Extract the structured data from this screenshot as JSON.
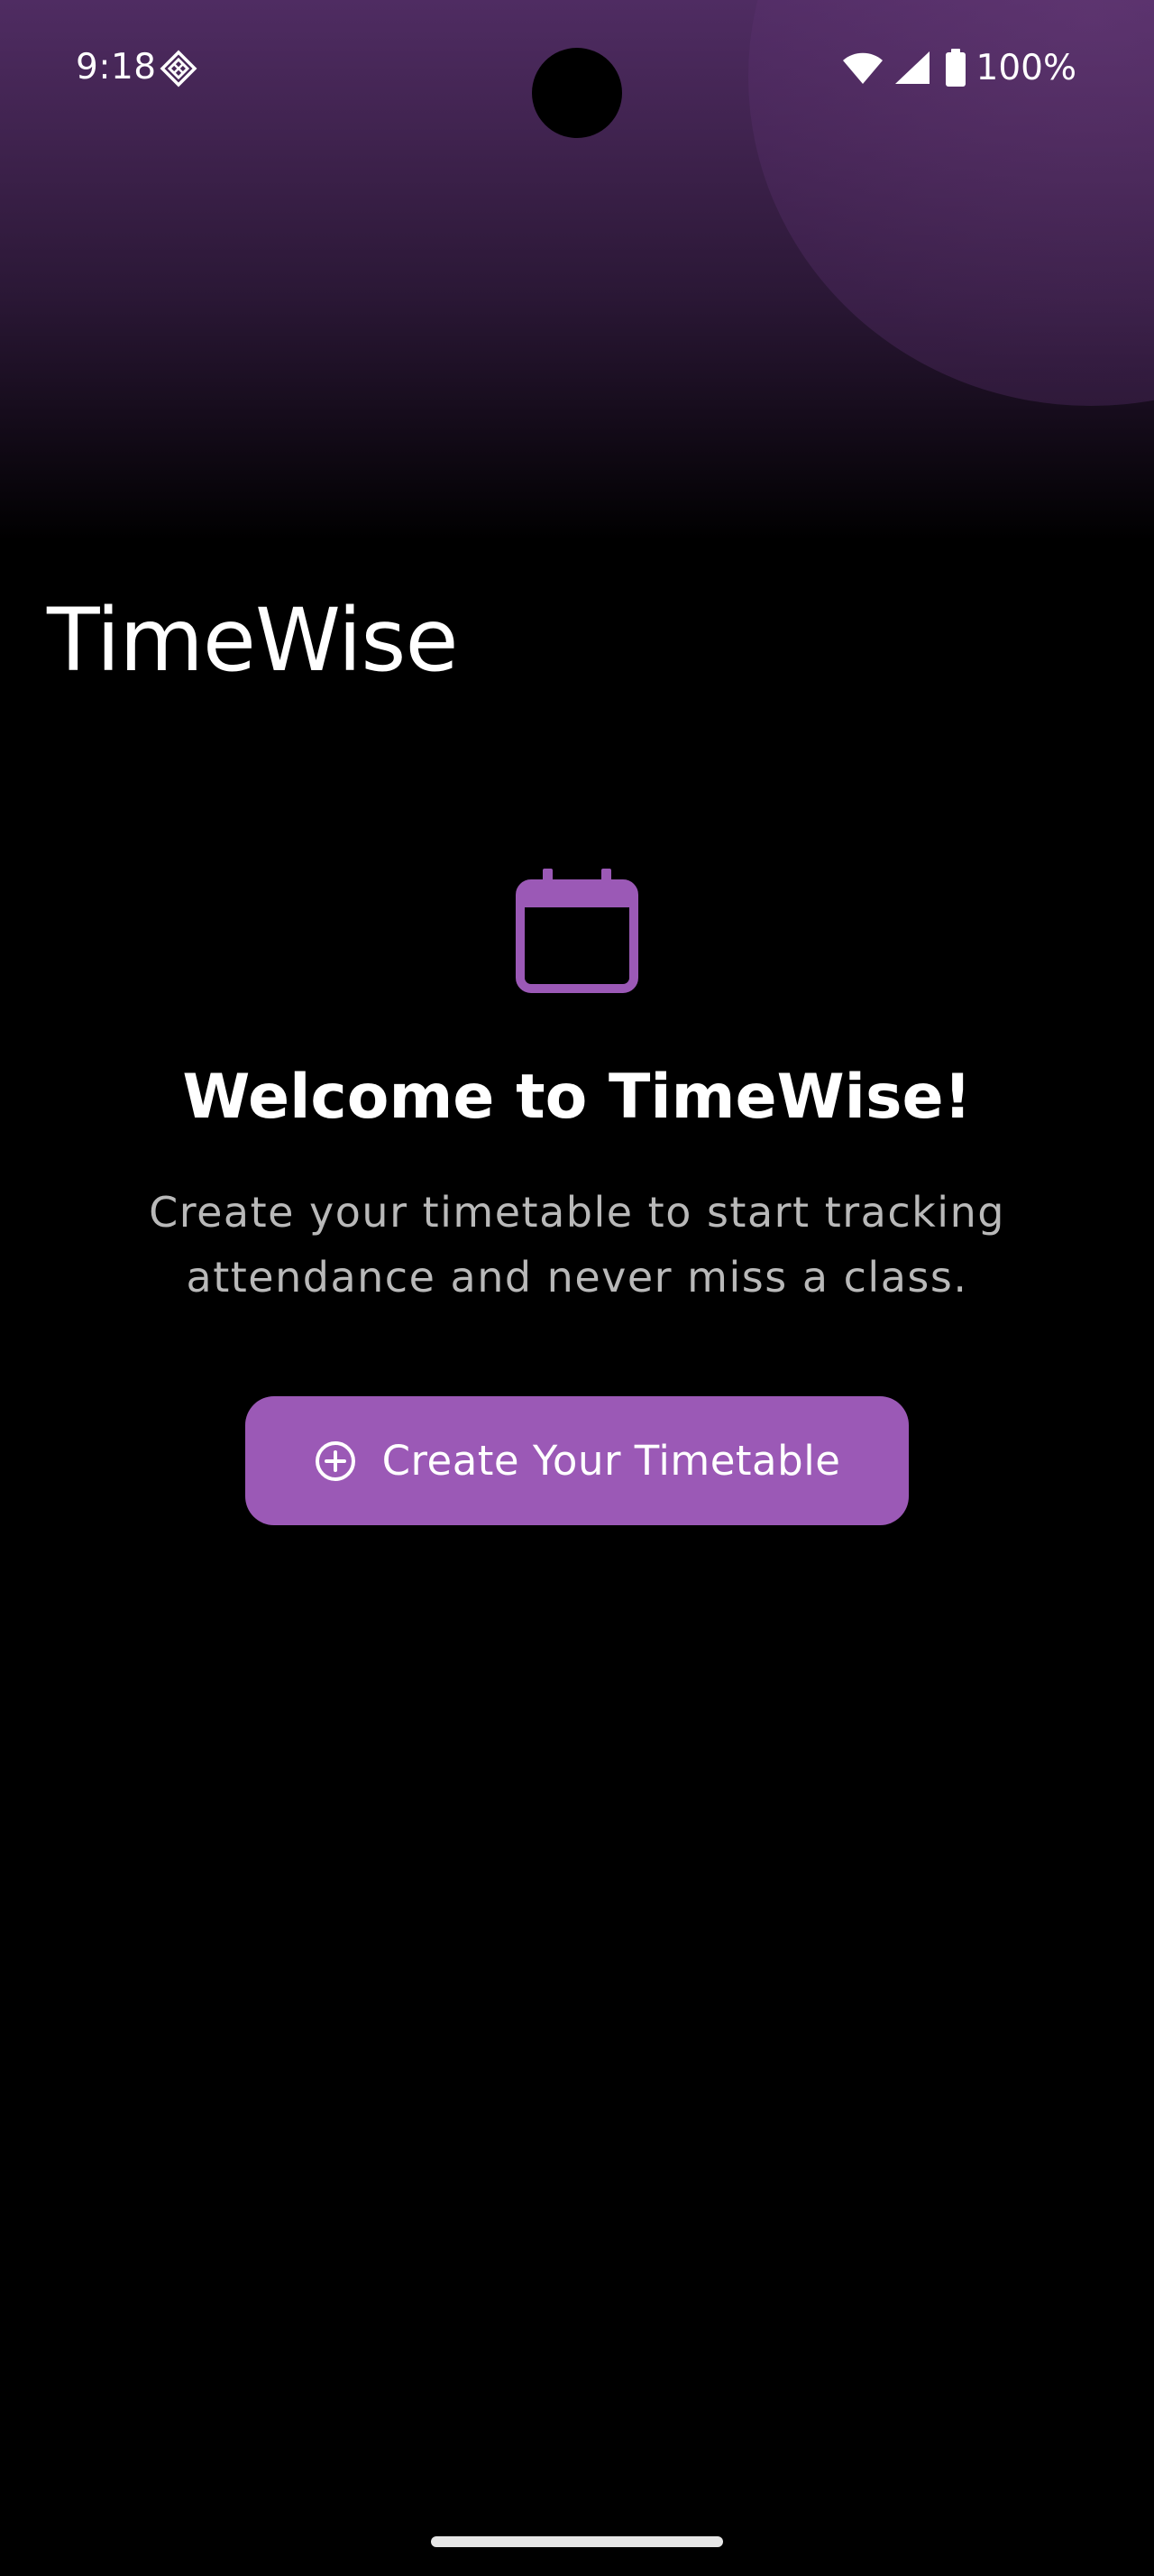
{
  "status_bar": {
    "time": "9:18",
    "notification_icon": "nfc-icon",
    "wifi_icon": "wifi-icon",
    "signal_icon": "cell-signal-icon",
    "battery_icon": "battery-icon",
    "battery_text": "100%"
  },
  "app": {
    "title": "TimeWise"
  },
  "empty_state": {
    "icon": "calendar-icon",
    "title": "Welcome to TimeWise!",
    "subtitle_line1": "Create your timetable to start tracking",
    "subtitle_line2": "attendance and never miss a class."
  },
  "create_button": {
    "icon": "add-circle-icon",
    "label": "Create Your Timetable"
  },
  "colors": {
    "accent": "#9b59b6",
    "background": "#000000",
    "header_tint": "#4f2c62",
    "subtitle_text": "#b9b9b9"
  }
}
